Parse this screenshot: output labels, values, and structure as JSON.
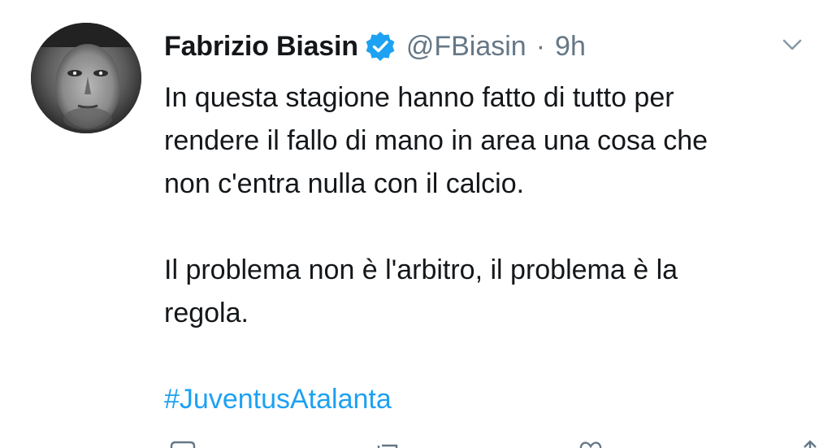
{
  "tweet": {
    "author": {
      "display_name": "Fabrizio Biasin",
      "handle": "@FBiasin",
      "verified": true,
      "avatar_icon": "user-photo-grayscale"
    },
    "separator": "·",
    "time": "9h",
    "body": {
      "paragraph_1": [
        "In questa stagione hanno fatto di tutto per",
        "rendere il fallo di mano in area una cosa che",
        "non c'entra nulla con il calcio."
      ],
      "paragraph_2": [
        "Il problema non è l'arbitro, il problema è la",
        "regola."
      ],
      "hashtag": "#JuventusAtalanta"
    },
    "menu_icon": "chevron-down-icon",
    "actions": [
      "reply-icon",
      "retweet-icon",
      "like-icon",
      "share-icon"
    ]
  },
  "colors": {
    "text": "#14171a",
    "muted": "#657786",
    "accent": "#1da1f2",
    "background": "#ffffff"
  }
}
